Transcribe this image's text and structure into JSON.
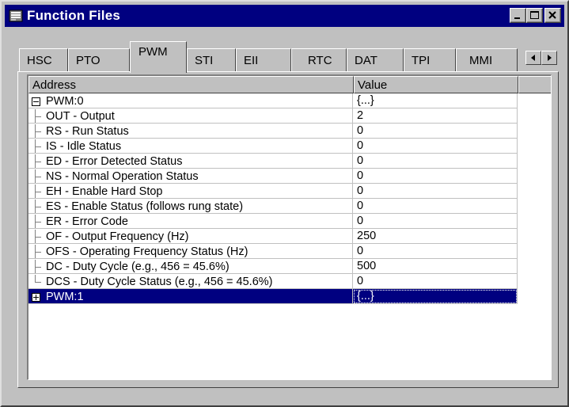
{
  "window": {
    "title": "Function Files",
    "app_icon": "function-files-icon",
    "buttons": [
      "minimize-icon",
      "maximize-icon",
      "close-icon"
    ]
  },
  "tabs": [
    {
      "label": "HSC"
    },
    {
      "label": "PTO"
    },
    {
      "label": "PWM",
      "active": true
    },
    {
      "label": "STI"
    },
    {
      "label": "EII"
    },
    {
      "label": "RTC"
    },
    {
      "label": "DAT"
    },
    {
      "label": "TPI"
    },
    {
      "label": "MMI"
    }
  ],
  "grid": {
    "headers": {
      "address": "Address",
      "value": "Value"
    },
    "rows": [
      {
        "address": "PWM:0",
        "value": "{...}",
        "type": "expanded"
      },
      {
        "address": "OUT - Output",
        "value": "2"
      },
      {
        "address": "RS - Run Status",
        "value": "0"
      },
      {
        "address": "IS - Idle Status",
        "value": "0"
      },
      {
        "address": "ED - Error Detected Status",
        "value": "0"
      },
      {
        "address": "NS - Normal Operation Status",
        "value": "0"
      },
      {
        "address": "EH - Enable Hard Stop",
        "value": "0"
      },
      {
        "address": "ES - Enable Status (follows rung state)",
        "value": "0"
      },
      {
        "address": "ER - Error Code",
        "value": "0"
      },
      {
        "address": "OF - Output Frequency (Hz)",
        "value": "250"
      },
      {
        "address": "OFS - Operating Frequency Status (Hz)",
        "value": "0"
      },
      {
        "address": "DC - Duty Cycle (e.g., 456 = 45.6%)",
        "value": "500"
      },
      {
        "address": "DCS - Duty Cycle Status (e.g., 456 = 45.6%)",
        "value": "0",
        "last": true
      },
      {
        "address": "PWM:1",
        "value": "{...}",
        "type": "collapsed",
        "selected": true
      }
    ]
  },
  "colors": {
    "title_bar": "#000080",
    "selection": "#000080",
    "face": "#c0c0c0"
  }
}
